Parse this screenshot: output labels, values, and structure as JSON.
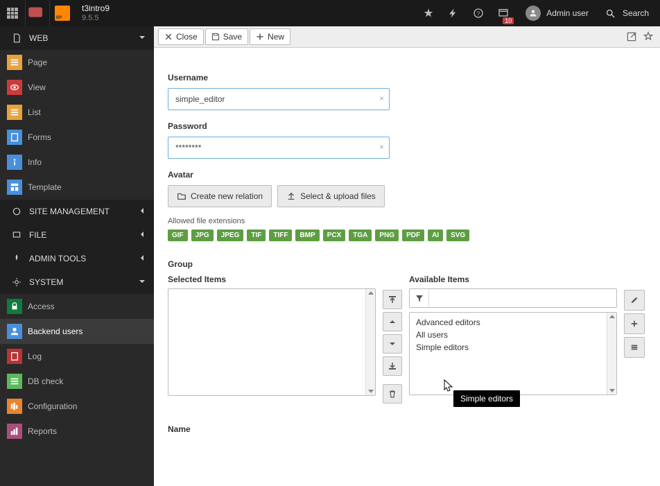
{
  "topbar": {
    "site_name": "t3intro9",
    "version": "9.5.5",
    "badge_count": "10",
    "user_name": "Admin user",
    "search_label": "Search"
  },
  "sidebar": {
    "sections": [
      {
        "label": "WEB",
        "items": [
          {
            "label": "Page",
            "color": "orange"
          },
          {
            "label": "View",
            "color": "red"
          },
          {
            "label": "List",
            "color": "orange"
          },
          {
            "label": "Forms",
            "color": "blue"
          },
          {
            "label": "Info",
            "color": "blue"
          },
          {
            "label": "Template",
            "color": "blue"
          }
        ]
      },
      {
        "label": "SITE MANAGEMENT",
        "items": []
      },
      {
        "label": "FILE",
        "items": []
      },
      {
        "label": "ADMIN TOOLS",
        "items": []
      },
      {
        "label": "SYSTEM",
        "items": [
          {
            "label": "Access",
            "color": "darkgreen"
          },
          {
            "label": "Backend users",
            "color": "blue",
            "active": true
          },
          {
            "label": "Log",
            "color": "redbar"
          },
          {
            "label": "DB check",
            "color": "green"
          },
          {
            "label": "Configuration",
            "color": "dkorange"
          },
          {
            "label": "Reports",
            "color": "purple"
          }
        ]
      }
    ]
  },
  "docheader": {
    "close": "Close",
    "save": "Save",
    "new": "New"
  },
  "form": {
    "username_label": "Username",
    "username_value": "simple_editor",
    "password_label": "Password",
    "password_value": "********",
    "avatar_label": "Avatar",
    "create_relation": "Create new relation",
    "select_upload": "Select & upload files",
    "allowed_ext_note": "Allowed file extensions",
    "extensions": [
      "GIF",
      "JPG",
      "JPEG",
      "TIF",
      "TIFF",
      "BMP",
      "PCX",
      "TGA",
      "PNG",
      "PDF",
      "AI",
      "SVG"
    ],
    "group_label": "Group",
    "selected_items_label": "Selected Items",
    "available_items_label": "Available Items",
    "available_items": [
      "Advanced editors",
      "All users",
      "Simple editors"
    ],
    "tooltip": "Simple editors",
    "name_label": "Name"
  }
}
